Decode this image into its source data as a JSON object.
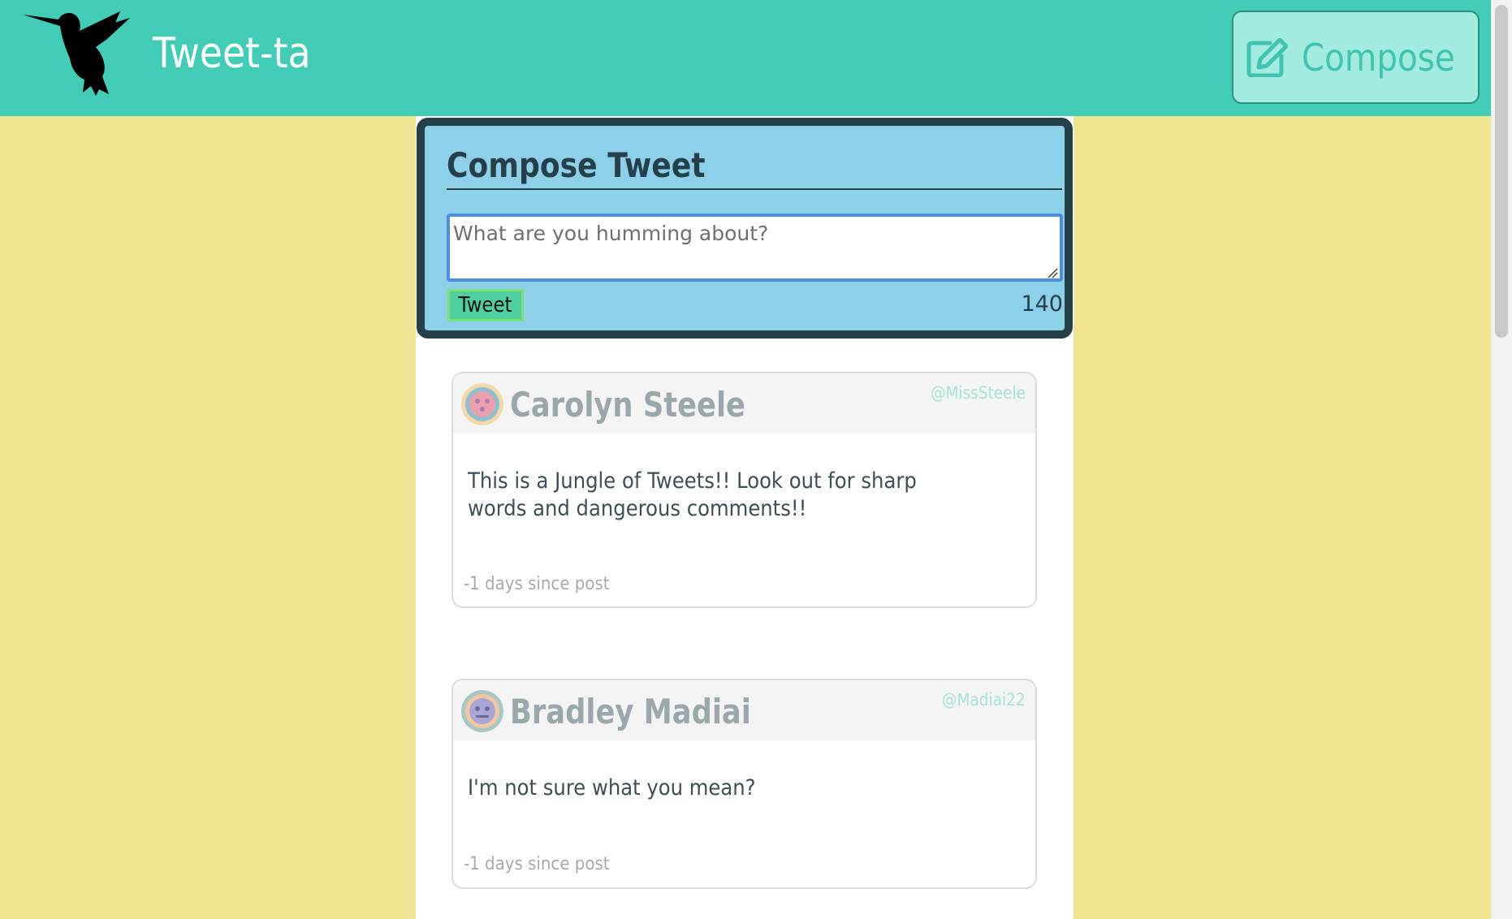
{
  "nav": {
    "brand": "Tweet-ta",
    "compose_label": "Compose"
  },
  "composer": {
    "title": "Compose Tweet",
    "placeholder": "What are you humming about?",
    "value": "",
    "submit_label": "Tweet",
    "counter": "140"
  },
  "tweets": [
    {
      "name": "Carolyn Steele",
      "handle": "@MissSteele",
      "text": "This is a Jungle of Tweets!! Look out for sharp words and dangerous comments!!",
      "meta": "-1 days since post"
    },
    {
      "name": "Bradley Madiai",
      "handle": "@Madiai22",
      "text": "I'm not sure what you mean?",
      "meta": "-1 days since post"
    }
  ],
  "colors": {
    "nav": "#41ccb7",
    "page_bg": "#efe48f",
    "composer_bg": "#8ecfe9",
    "composer_border": "#24404a",
    "tweet_button": "#4fd09f"
  },
  "icons": {
    "logo": "hummingbird-logo",
    "compose": "edit-icon",
    "avatar_1": "avatar-icon",
    "avatar_2": "avatar-icon"
  }
}
